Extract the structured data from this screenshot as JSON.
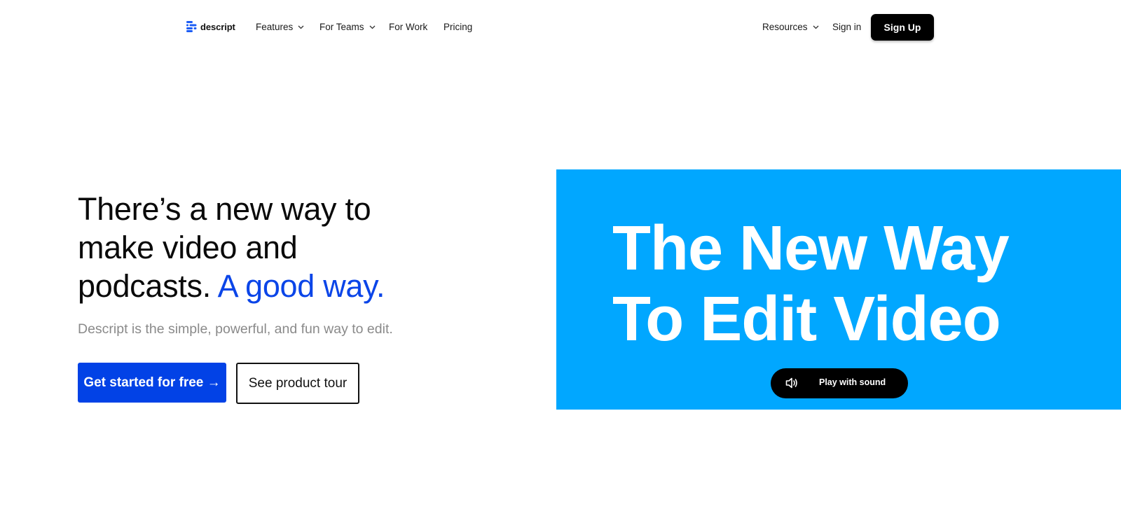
{
  "nav": {
    "logo_text": "descript",
    "items": [
      {
        "label": "Features",
        "has_dropdown": true
      },
      {
        "label": "For Teams",
        "has_dropdown": true
      },
      {
        "label": "For Work",
        "has_dropdown": false
      },
      {
        "label": "Pricing",
        "has_dropdown": false
      }
    ],
    "resources": {
      "label": "Resources",
      "has_dropdown": true
    },
    "sign_in": "Sign in",
    "sign_up": "Sign Up"
  },
  "hero": {
    "headline_line1": "There’s a new way to",
    "headline_line2": "make video and",
    "headline_line3": "podcasts.",
    "headline_accent": "A good way.",
    "subheadline": "Descript is the simple, powerful, and fun way to edit.",
    "primary_cta": "Get started for free →",
    "secondary_cta": "See product tour"
  },
  "video": {
    "title_line1": "The New Way",
    "title_line2": "To Edit Video",
    "play_label": "Play with sound"
  },
  "colors": {
    "accent_blue": "#0242e6",
    "headline_accent": "#0b45e8",
    "video_bg": "#01a7ff",
    "logo_blue": "#1b5cf5"
  }
}
